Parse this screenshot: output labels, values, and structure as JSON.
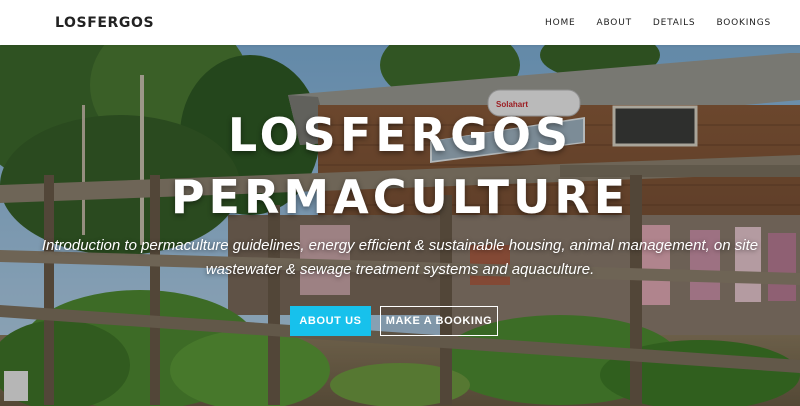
{
  "navbar": {
    "brand": "LOSFERGOS",
    "links": [
      {
        "label": "HOME"
      },
      {
        "label": "ABOUT"
      },
      {
        "label": "DETAILS"
      },
      {
        "label": "BOOKINGS"
      }
    ]
  },
  "hero": {
    "title_line1": "LOSFERGOS",
    "title_line2": "PERMACULTURE",
    "subtitle_line1": "Introduction to permaculture guidelines, energy efficient & sustainable housing, animal management, on site",
    "subtitle_line2": "wastewater & sewage treatment systems and aquaculture.",
    "primary_button": "ABOUT US",
    "secondary_button": "MAKE A BOOKING",
    "solar_brand": "Solahart"
  },
  "colors": {
    "accent": "#17c1ec",
    "nav_bg": "#ffffff",
    "text_dark": "#222222"
  }
}
